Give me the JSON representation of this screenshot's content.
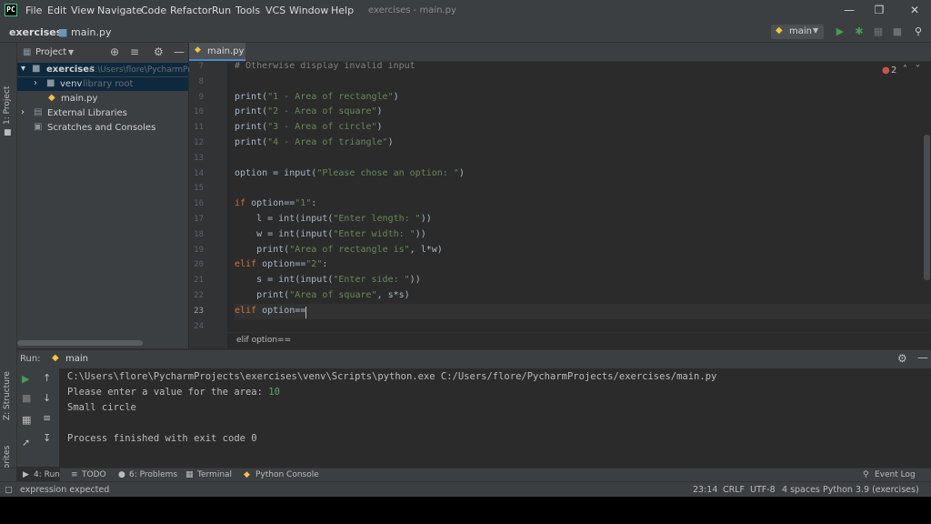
{
  "menu": [
    "File",
    "Edit",
    "View",
    "Navigate",
    "Code",
    "Refactor",
    "Run",
    "Tools",
    "VCS",
    "Window",
    "Help"
  ],
  "window_title": "exercises - main.py",
  "logo_text": "PC",
  "breadcrumb": {
    "project": "exercises",
    "file": "main.py"
  },
  "run_config": "main",
  "project_panel": {
    "title": "Project",
    "root": "exercises",
    "root_path": "C:\\Users\\flore\\PycharmPr",
    "venv": "venv",
    "venv_note": "library root",
    "main": "main.py",
    "external": "External Libraries",
    "scratches": "Scratches and Consoles"
  },
  "editor_tab": "main.py",
  "inspection_count": "2",
  "code_lines": [
    {
      "n": "7",
      "text": "# Otherwise display invalid input"
    },
    {
      "n": "8",
      "text": ""
    },
    {
      "n": "9",
      "text": "print(\"1 - Area of rectangle\")"
    },
    {
      "n": "10",
      "text": "print(\"2 - Area of square\")"
    },
    {
      "n": "11",
      "text": "print(\"3 - Area of circle\")"
    },
    {
      "n": "12",
      "text": "print(\"4 - Area of triangle\")"
    },
    {
      "n": "13",
      "text": ""
    },
    {
      "n": "14",
      "text": "option = input(\"Please chose an option: \")"
    },
    {
      "n": "15",
      "text": ""
    },
    {
      "n": "16",
      "text": "if option==\"1\":"
    },
    {
      "n": "17",
      "text": "    l = int(input(\"Enter length: \"))"
    },
    {
      "n": "18",
      "text": "    w = int(input(\"Enter width: \"))"
    },
    {
      "n": "19",
      "text": "    print(\"Area of rectangle is\", l*w)"
    },
    {
      "n": "20",
      "text": "elif option==\"2\":"
    },
    {
      "n": "21",
      "text": "    s = int(input(\"Enter side: \"))"
    },
    {
      "n": "22",
      "text": "    print(\"Area of square\", s*s)"
    },
    {
      "n": "23",
      "text": "elif option=="
    },
    {
      "n": "24",
      "text": ""
    }
  ],
  "editor_breadcrumb": "elif option==",
  "run_panel": {
    "label": "Run:",
    "tab": "main",
    "output": [
      "C:\\Users\\flore\\PycharmProjects\\exercises\\venv\\Scripts\\python.exe C:/Users/flore/PycharmProjects/exercises/main.py",
      "Please enter a value for the area: ",
      "Small circle",
      "",
      "Process finished with exit code 0"
    ],
    "user_input": "10"
  },
  "left_stripe": {
    "project": "1: Project",
    "structure": "Z: Structure",
    "favorites": "2: Favorites"
  },
  "bottom_tools": {
    "run": "4: Run",
    "todo": "TODO",
    "problems": "6: Problems",
    "terminal": "Terminal",
    "python_console": "Python Console",
    "event_log": "Event Log"
  },
  "status": {
    "message": "expression expected",
    "position": "23:14",
    "line_sep": "CRLF",
    "encoding": "UTF-8",
    "indent": "4 spaces",
    "interpreter": "Python 3.9 (exercises)"
  },
  "colors": {
    "bg": "#2b2b2b",
    "panel": "#3c3f41",
    "keyword": "#cc7832",
    "string": "#6a8759",
    "run_green": "#499c54",
    "error_red": "#c75450"
  }
}
